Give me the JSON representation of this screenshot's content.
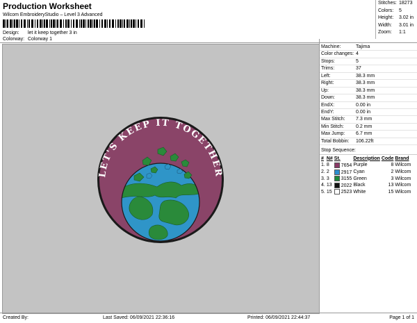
{
  "header": {
    "title": "Production Worksheet",
    "subtitle": "Wilcom EmbroideryStudio – Level 3 Advanced"
  },
  "meta": [
    {
      "label": "Design:",
      "value": "let it keep together 3 in"
    },
    {
      "label": "Colorway:",
      "value": "Colorway 1"
    }
  ],
  "top_stats": [
    {
      "label": "Stitches:",
      "value": "18273"
    },
    {
      "label": "Colors:",
      "value": "5"
    },
    {
      "label": "Height:",
      "value": "3.02 in"
    },
    {
      "label": "Width:",
      "value": "3.01 in"
    },
    {
      "label": "Zoom:",
      "value": "1:1"
    }
  ],
  "machine_info": [
    {
      "label": "Machine:",
      "value": "Tajima"
    },
    {
      "label": "Color changes:",
      "value": "4"
    },
    {
      "label": "Stops:",
      "value": "5"
    },
    {
      "label": "Trims:",
      "value": "37"
    },
    {
      "label": "Left:",
      "value": "38.3 mm"
    },
    {
      "label": "Right:",
      "value": "38.3 mm"
    },
    {
      "label": "Up:",
      "value": "38.3 mm"
    },
    {
      "label": "Down:",
      "value": "38.3 mm"
    },
    {
      "label": "EndX:",
      "value": "0.00 in"
    },
    {
      "label": "EndY:",
      "value": "0.00 in"
    },
    {
      "label": "Max Stitch:",
      "value": "7.3 mm"
    },
    {
      "label": "Min Stitch:",
      "value": "0.2 mm"
    },
    {
      "label": "Max Jump:",
      "value": "6.7 mm"
    },
    {
      "label": "Total Bobbin:",
      "value": "106.22ft"
    }
  ],
  "stop_sequence": {
    "heading": "Stop Sequence:",
    "columns": [
      "#",
      "N#",
      "St.",
      "Description",
      "Code",
      "Brand"
    ],
    "rows": [
      {
        "n": "1.",
        "needle": "8",
        "st": "7654",
        "desc": "Purple",
        "code": "8",
        "brand": "Wilcom",
        "color": "#8a3a66"
      },
      {
        "n": "2.",
        "needle": "2",
        "st": "2917",
        "desc": "Cyan",
        "code": "2",
        "brand": "Wilcom",
        "color": "#2d8fd0"
      },
      {
        "n": "3.",
        "needle": "3",
        "st": "3155",
        "desc": "Green",
        "code": "3",
        "brand": "Wilcom",
        "color": "#1e8a3a"
      },
      {
        "n": "4.",
        "needle": "13",
        "st": "2022",
        "desc": "Black",
        "code": "13",
        "brand": "Wilcom",
        "color": "#111111"
      },
      {
        "n": "5.",
        "needle": "15",
        "st": "2523",
        "desc": "White",
        "code": "15",
        "brand": "Wilcom",
        "color": "#ffffff"
      }
    ]
  },
  "design": {
    "arc_text": "LET'S KEEP IT TOGETHER",
    "colors": {
      "patch": "#8a4468",
      "rim": "#1a1a1a",
      "ocean": "#2f95c8",
      "land": "#2a8a3a",
      "text": "#ffffff"
    }
  },
  "footer": {
    "created": "Created By:",
    "saved": "Last Saved: 06/09/2021 22:36:16",
    "printed": "Printed: 06/09/2021 22:44:37",
    "page": "Page 1 of 1"
  }
}
